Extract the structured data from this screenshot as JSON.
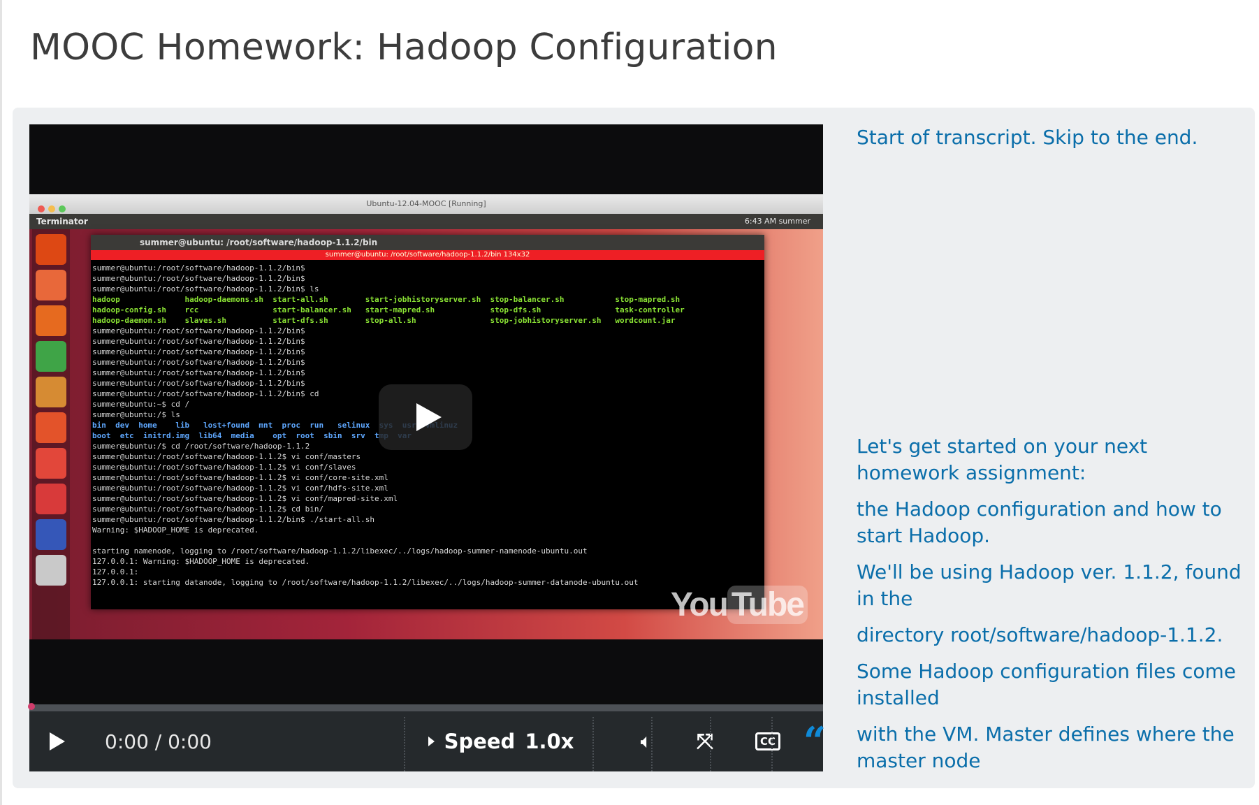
{
  "page": {
    "title": "MOOC Homework: Hadoop Configuration"
  },
  "video": {
    "vm_title": "Ubuntu-12.04-MOOC [Running]",
    "topbar_left": "Terminator",
    "topbar_right": "6:43 AM  summer",
    "terminal_title": "summer@ubuntu: /root/software/hadoop-1.1.2/bin",
    "terminal_subtitle": "summer@ubuntu: /root/software/hadoop-1.1.2/bin 134x32",
    "terminal_lines": [
      "summer@ubuntu:/root/software/hadoop-1.1.2/bin$",
      "summer@ubuntu:/root/software/hadoop-1.1.2/bin$",
      "summer@ubuntu:/root/software/hadoop-1.1.2/bin$ ls",
      "hadoop              hadoop-daemons.sh  start-all.sh        start-jobhistoryserver.sh  stop-balancer.sh           stop-mapred.sh",
      "hadoop-config.sh    rcc                start-balancer.sh   start-mapred.sh            stop-dfs.sh                task-controller",
      "hadoop-daemon.sh    slaves.sh          start-dfs.sh        stop-all.sh                stop-jobhistoryserver.sh   wordcount.jar",
      "summer@ubuntu:/root/software/hadoop-1.1.2/bin$",
      "summer@ubuntu:/root/software/hadoop-1.1.2/bin$",
      "summer@ubuntu:/root/software/hadoop-1.1.2/bin$",
      "summer@ubuntu:/root/software/hadoop-1.1.2/bin$",
      "summer@ubuntu:/root/software/hadoop-1.1.2/bin$",
      "summer@ubuntu:/root/software/hadoop-1.1.2/bin$",
      "summer@ubuntu:/root/software/hadoop-1.1.2/bin$ cd",
      "summer@ubuntu:~$ cd /",
      "summer@ubuntu:/$ ls",
      "bin  dev  home    lib   lost+found  mnt  proc  run   selinux  sys  usr  vmlinuz",
      "boot  etc  initrd.img  lib64  media    opt  root  sbin  srv  tmp  var",
      "summer@ubuntu:/$ cd /root/software/hadoop-1.1.2",
      "summer@ubuntu:/root/software/hadoop-1.1.2$ vi conf/masters",
      "summer@ubuntu:/root/software/hadoop-1.1.2$ vi conf/slaves",
      "summer@ubuntu:/root/software/hadoop-1.1.2$ vi conf/core-site.xml",
      "summer@ubuntu:/root/software/hadoop-1.1.2$ vi conf/hdfs-site.xml",
      "summer@ubuntu:/root/software/hadoop-1.1.2$ vi conf/mapred-site.xml",
      "summer@ubuntu:/root/software/hadoop-1.1.2$ cd bin/",
      "summer@ubuntu:/root/software/hadoop-1.1.2/bin$ ./start-all.sh",
      "Warning: $HADOOP_HOME is deprecated.",
      "",
      "starting namenode, logging to /root/software/hadoop-1.1.2/libexec/../logs/hadoop-summer-namenode-ubuntu.out",
      "127.0.0.1: Warning: $HADOOP_HOME is deprecated.",
      "127.0.0.1:",
      "127.0.0.1: starting datanode, logging to /root/software/hadoop-1.1.2/libexec/../logs/hadoop-summer-datanode-ubuntu.out"
    ],
    "watermark": {
      "you": "You",
      "tube": "Tube"
    },
    "controls": {
      "time": "0:00 / 0:00",
      "speed_label": "Speed",
      "speed_value": "1.0x",
      "cc_label": "CC",
      "transcript_icon": "“"
    },
    "progress": 0
  },
  "transcript": {
    "start": "Start of transcript. Skip to the end.",
    "lines": [
      "Let's get started on your next homework assignment:",
      "the Hadoop configuration and how to start Hadoop.",
      "We'll be using Hadoop ver. 1.1.2, found in the",
      "directory root/software/hadoop-1.1.2.",
      "Some Hadoop configuration files come installed",
      "with the VM. Master defines where the master node"
    ]
  },
  "colors": {
    "link": "#0a6eaa",
    "control_bar": "#25292c",
    "progress_dot": "#d03c6b",
    "transcript_toggle": "#0f8ad8"
  }
}
